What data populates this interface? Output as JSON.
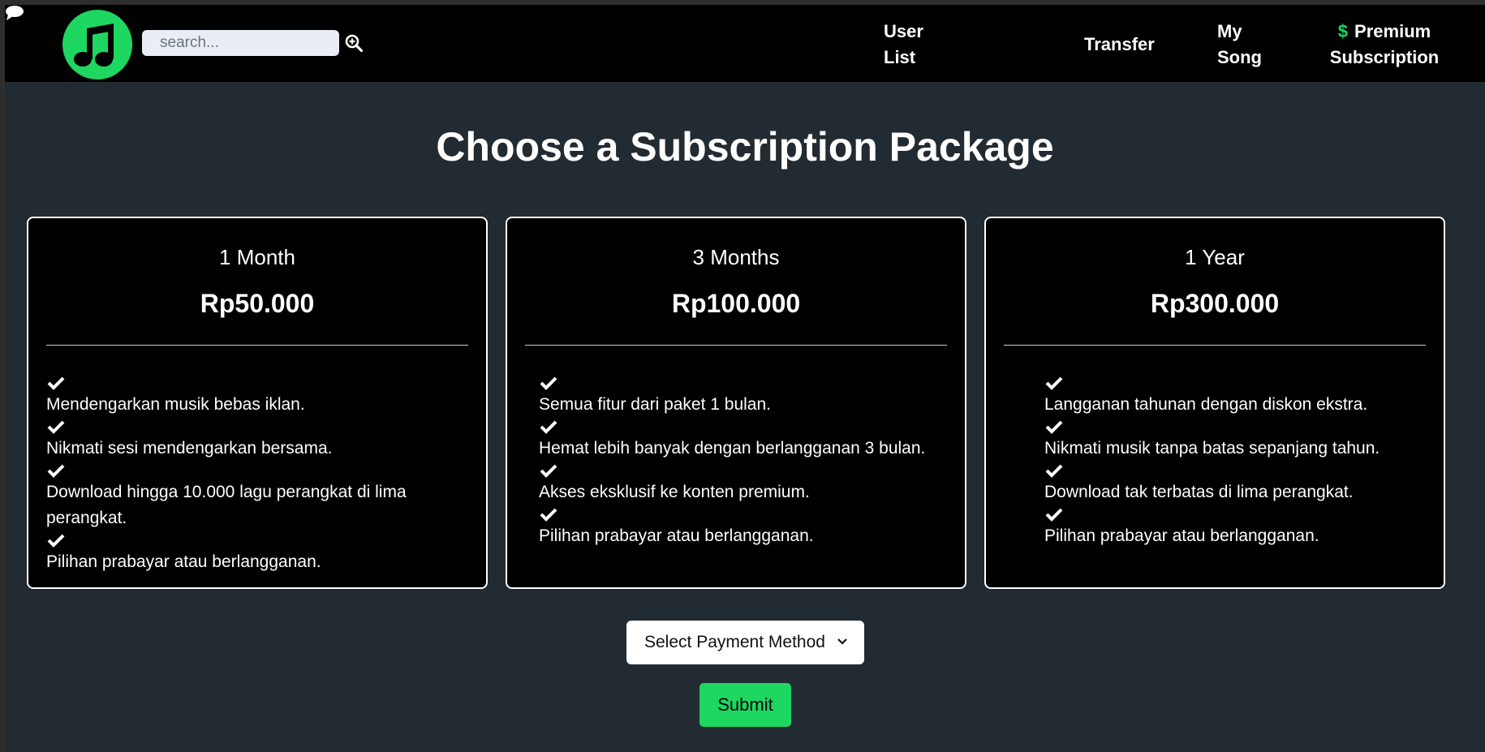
{
  "header": {
    "logo_icon": "music-note-icon",
    "search_placeholder": "search...",
    "search_icon": "zoom-in-icon",
    "nav": {
      "user_list": "User List",
      "chat_icon": "chat-bubble-icon",
      "transfer": "Transfer",
      "my_song": "My Song",
      "premium_symbol": "$",
      "premium": "Premium Subscription"
    }
  },
  "colors": {
    "accent": "#1ed760",
    "page_bg": "#222a32",
    "card_bg": "#000000"
  },
  "page": {
    "title": "Choose a Subscription Package"
  },
  "plans": [
    {
      "name": "1 Month",
      "price": "Rp50.000",
      "features": [
        "Mendengarkan musik bebas iklan.",
        "Nikmati sesi mendengarkan bersama.",
        "Download hingga 10.000 lagu perangkat di lima perangkat.",
        "Pilihan prabayar atau berlangganan."
      ]
    },
    {
      "name": "3 Months",
      "price": "Rp100.000",
      "features": [
        "Semua fitur dari paket 1 bulan.",
        "Hemat lebih banyak dengan berlangganan 3 bulan.",
        "Akses eksklusif ke konten premium.",
        "Pilihan prabayar atau berlangganan."
      ]
    },
    {
      "name": "1 Year",
      "price": "Rp300.000",
      "features": [
        "Langganan tahunan dengan diskon ekstra.",
        "Nikmati musik tanpa batas sepanjang tahun.",
        "Download tak terbatas di lima perangkat.",
        "Pilihan prabayar atau berlangganan."
      ]
    }
  ],
  "payment": {
    "select_label": "Select Payment Method"
  },
  "submit_label": "Submit"
}
